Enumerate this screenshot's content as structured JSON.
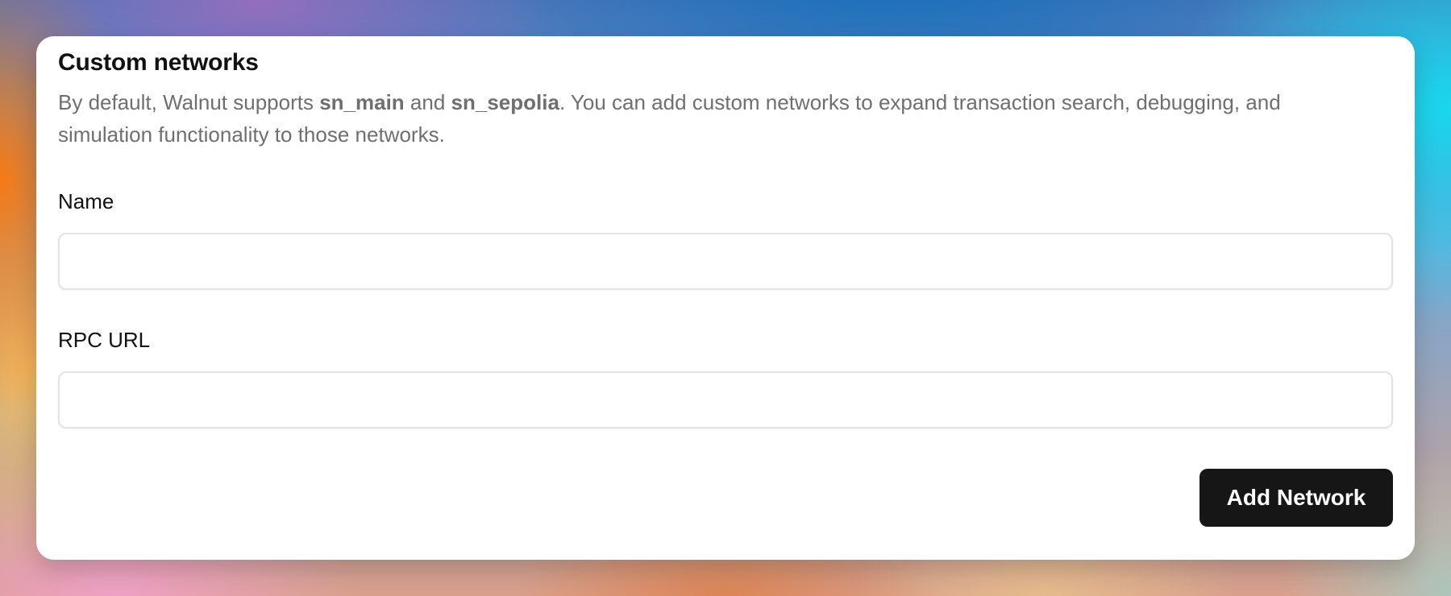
{
  "section": {
    "title": "Custom networks",
    "description": {
      "part1": "By default, Walnut supports ",
      "network1": "sn_main",
      "part2": " and ",
      "network2": "sn_sepolia",
      "part3": ". You can add custom networks to expand transaction search, debugging, and simulation functionality to those networks."
    }
  },
  "form": {
    "name_label": "Name",
    "name_value": "",
    "rpc_label": "RPC URL",
    "rpc_value": "",
    "submit_label": "Add Network"
  },
  "colors": {
    "button_background": "#161616",
    "description_text": "#6f6f6f",
    "card_background": "#ffffff"
  }
}
